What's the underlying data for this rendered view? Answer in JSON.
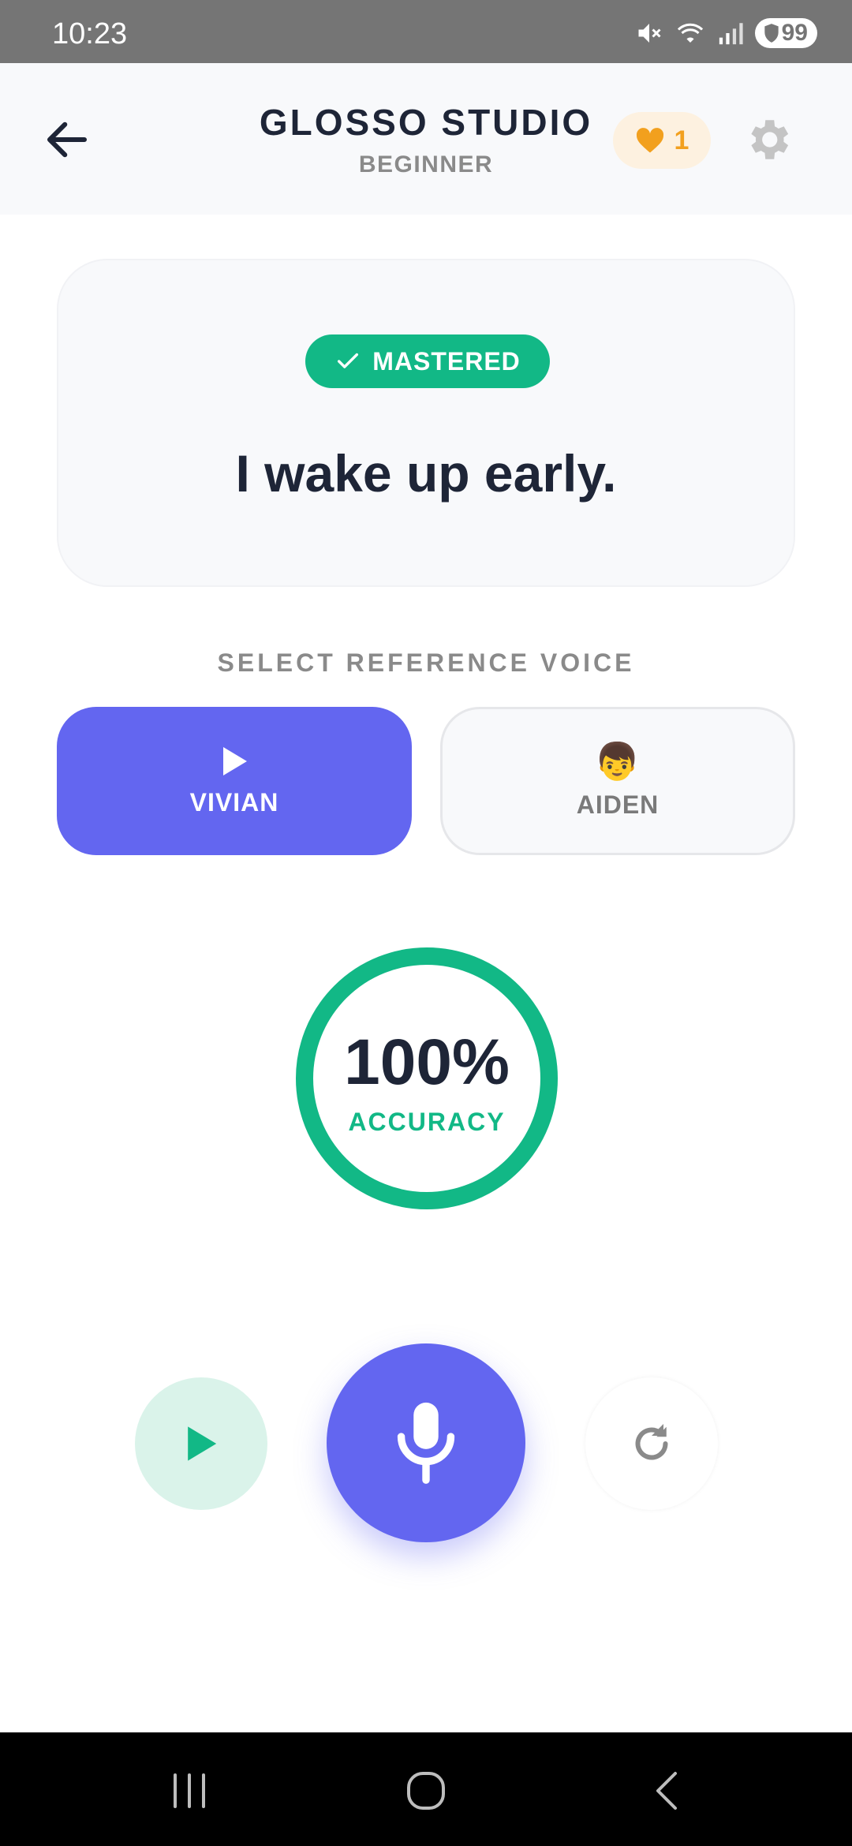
{
  "status_bar": {
    "time": "10:23",
    "battery": "99"
  },
  "header": {
    "title": "GLOSSO STUDIO",
    "subtitle": "BEGINNER",
    "hearts_count": "1"
  },
  "phrase_card": {
    "badge_label": "MASTERED",
    "phrase": "I wake up early."
  },
  "voice_section": {
    "label": "SELECT REFERENCE VOICE",
    "voices": [
      {
        "name": "VIVIAN",
        "selected": true,
        "icon": "play-icon"
      },
      {
        "name": "AIDEN",
        "selected": false,
        "icon": "boy-emoji",
        "emoji": "👦"
      }
    ]
  },
  "accuracy": {
    "value": "100%",
    "label": "ACCURACY",
    "percent": 100
  },
  "controls": {
    "play": "play-icon",
    "record": "microphone-icon",
    "retry": "refresh-icon"
  },
  "colors": {
    "primary": "#6366f0",
    "success": "#12b886",
    "heart": "#f2a01e",
    "text_dark": "#1e2537",
    "text_muted": "#8a8a8a"
  }
}
